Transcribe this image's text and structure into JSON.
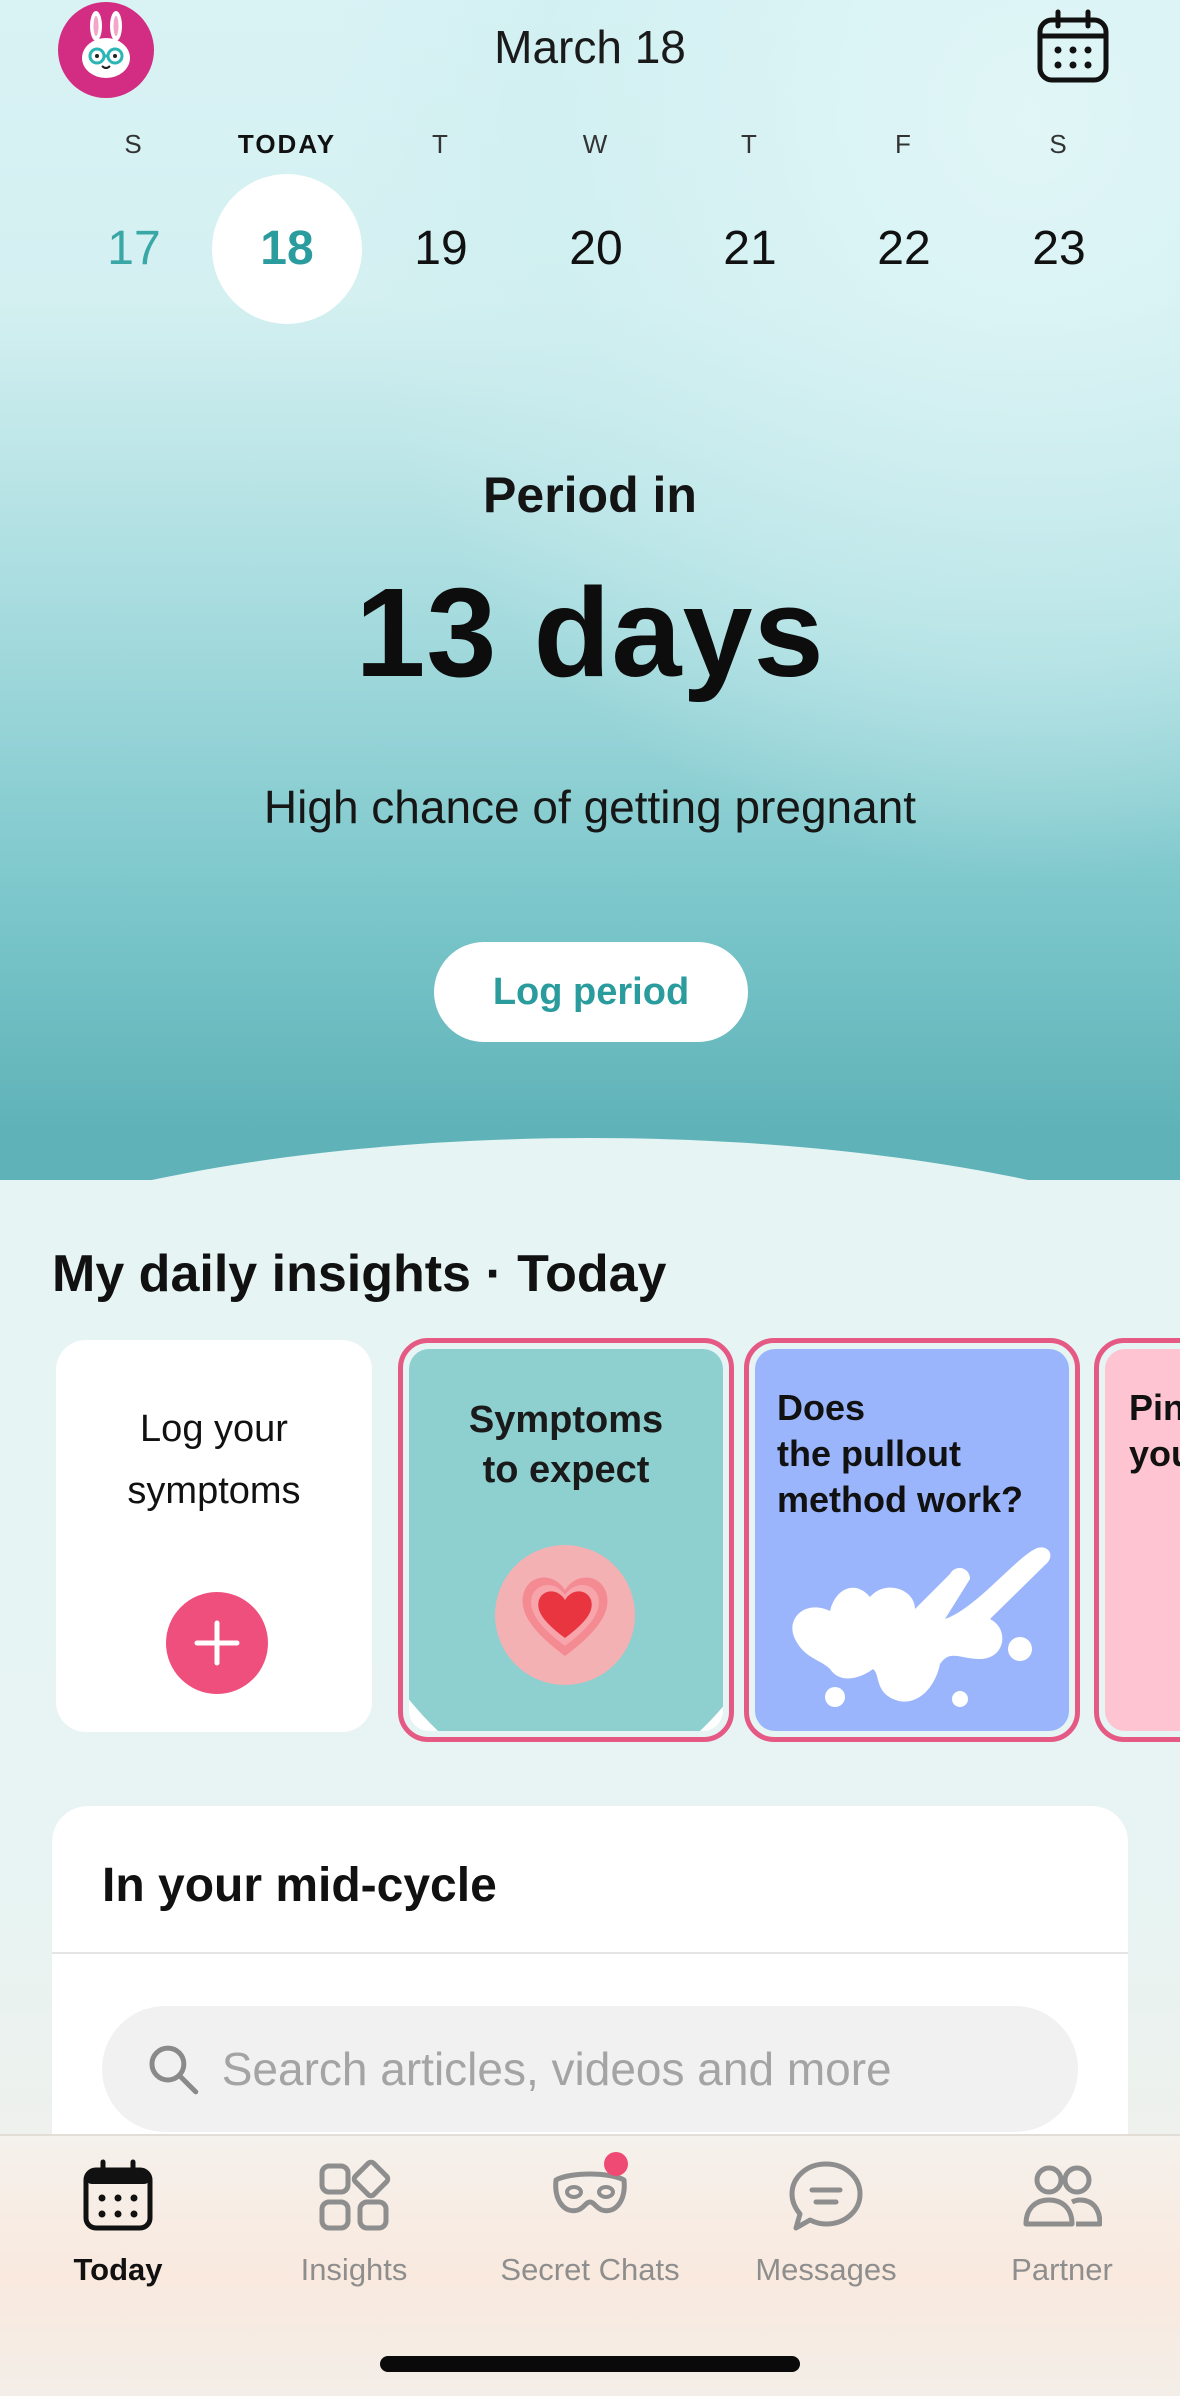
{
  "header": {
    "title": "March 18"
  },
  "week": [
    {
      "day": "S",
      "date": "17",
      "state": "past"
    },
    {
      "day": "TODAY",
      "date": "18",
      "state": "today"
    },
    {
      "day": "T",
      "date": "19",
      "state": "future"
    },
    {
      "day": "W",
      "date": "20",
      "state": "future"
    },
    {
      "day": "T",
      "date": "21",
      "state": "future"
    },
    {
      "day": "F",
      "date": "22",
      "state": "future"
    },
    {
      "day": "S",
      "date": "23",
      "state": "future"
    }
  ],
  "hero": {
    "label": "Period in",
    "days": "13 days",
    "chance": "High chance of getting pregnant",
    "log_button": "Log period"
  },
  "insights": {
    "title": "My daily insights · Today",
    "log_card": {
      "line1": "Log your",
      "line2": "symptoms"
    },
    "cards": [
      {
        "line1": "Symptoms",
        "line2": "to expect"
      },
      {
        "line1": "Does",
        "line2": "the pullout",
        "line3": "method work?"
      },
      {
        "line1": "Pin",
        "line2": "you"
      }
    ]
  },
  "mid_cycle": {
    "title": "In your mid-cycle",
    "search_placeholder": "Search articles, videos and more"
  },
  "tabs": [
    {
      "label": "Today",
      "icon": "calendar-icon",
      "active": true
    },
    {
      "label": "Insights",
      "icon": "insights-icon",
      "active": false
    },
    {
      "label": "Secret Chats",
      "icon": "mask-icon",
      "active": false,
      "badge": true
    },
    {
      "label": "Messages",
      "icon": "chat-bubble-icon",
      "active": false
    },
    {
      "label": "Partner",
      "icon": "partner-icon",
      "active": false
    }
  ],
  "colors": {
    "accent_teal": "#2a9c9e",
    "brand_pink": "#ee4f7d",
    "avatar_magenta": "#d22d82",
    "story_border": "#e55a84"
  }
}
